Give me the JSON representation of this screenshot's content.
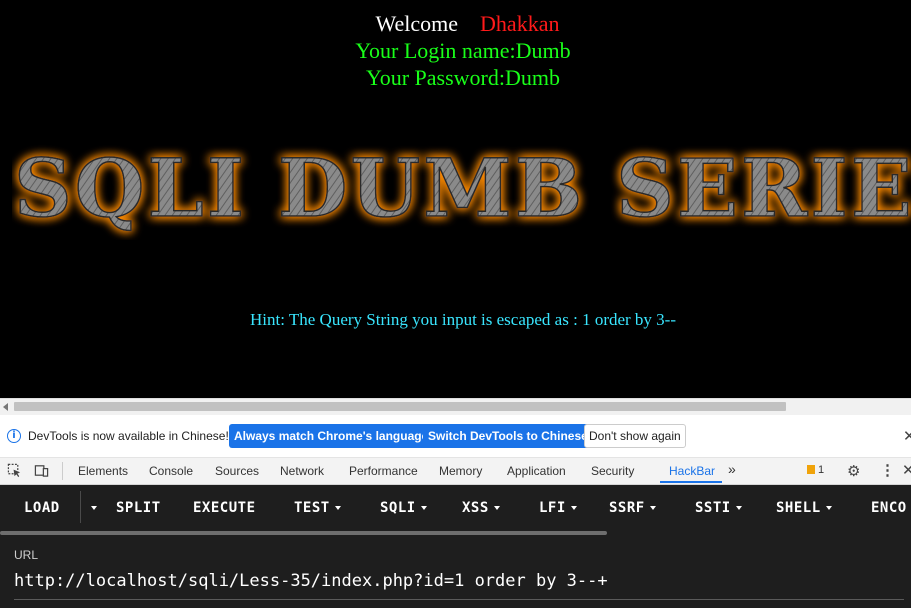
{
  "page": {
    "welcome": "Welcome",
    "user_name": "Dhakkan",
    "login_line": "Your Login name:Dumb",
    "password_line": "Your Password:Dumb",
    "banner_text": "SQLI DUMB SERIES",
    "hint": "Hint: The Query String you input is escaped as : 1 order by 3--"
  },
  "colors": {
    "welcome": "#ffffff",
    "user_name": "#ff1a1a",
    "login": "#19ff19",
    "hint": "#39e6ff",
    "banner_glow": "#ff8c00"
  },
  "devtools": {
    "infobar": {
      "message": "DevTools is now available in Chinese!",
      "btn_match": "Always match Chrome's language",
      "btn_switch": "Switch DevTools to Chinese",
      "btn_dismiss": "Don't show again"
    },
    "tabs": [
      "Elements",
      "Console",
      "Sources",
      "Network",
      "Performance",
      "Memory",
      "Application",
      "Security",
      "HackBar"
    ],
    "active_tab": "HackBar",
    "issues_count": "1"
  },
  "hackbar": {
    "load": "LOAD",
    "split": "SPLIT",
    "execute": "EXECUTE",
    "test": "TEST",
    "sqli": "SQLI",
    "xss": "XSS",
    "lfi": "LFI",
    "ssrf": "SSRF",
    "ssti": "SSTI",
    "shell": "SHELL",
    "encoding": "ENCO",
    "url_label": "URL",
    "url_value": "http://localhost/sqli/Less-35/index.php?id=1 order by 3--+"
  }
}
